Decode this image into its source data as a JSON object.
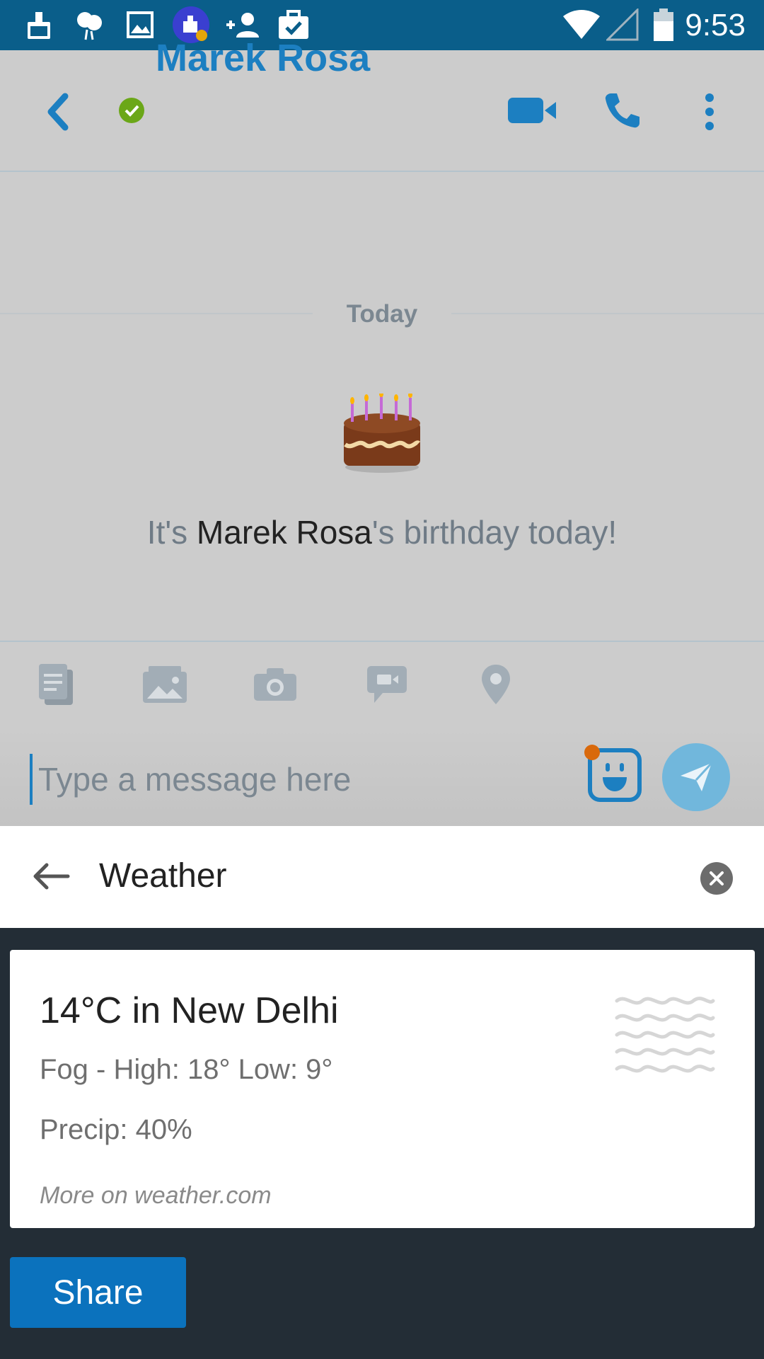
{
  "status_bar": {
    "time": "9:53",
    "icons": [
      "cleaner-icon",
      "balloons-icon",
      "image-icon",
      "app-notification-icon",
      "add-contact-icon",
      "briefcase-check-icon",
      "wifi-icon",
      "signal-icon",
      "battery-icon"
    ]
  },
  "header": {
    "contact_name": "Marek Rosa",
    "presence": "online",
    "icons": [
      "back-icon",
      "video-call-icon",
      "phone-icon",
      "more-icon"
    ]
  },
  "chat": {
    "date_separator": "Today",
    "birthday_prefix": "It's ",
    "birthday_name": "Marek Rosa",
    "birthday_suffix": "'s birthday today!",
    "cake": "birthday-cake-icon"
  },
  "attach_toolbar": {
    "icons": [
      "file-icon",
      "photo-gallery-icon",
      "camera-icon",
      "video-message-icon",
      "location-icon"
    ]
  },
  "composer": {
    "placeholder": "Type a message here",
    "value": "",
    "icons": [
      "emoticon-icon",
      "send-icon"
    ]
  },
  "search": {
    "query": "Weather",
    "icons": [
      "arrow-back-icon",
      "clear-icon"
    ]
  },
  "weather_card": {
    "title": "14°C in New Delhi",
    "conditions": "Fog - High: 18° Low: 9°",
    "precip": "Precip: 40%",
    "more_link": "More on weather.com",
    "icon": "fog-icon"
  },
  "share_button": {
    "label": "Share"
  },
  "colors": {
    "status_bar": "#0a5e8a",
    "accent": "#1c7fc1",
    "presence": "#6ba718",
    "panel": "#232d36",
    "share": "#0b72bd",
    "send": "#71b7dc"
  }
}
